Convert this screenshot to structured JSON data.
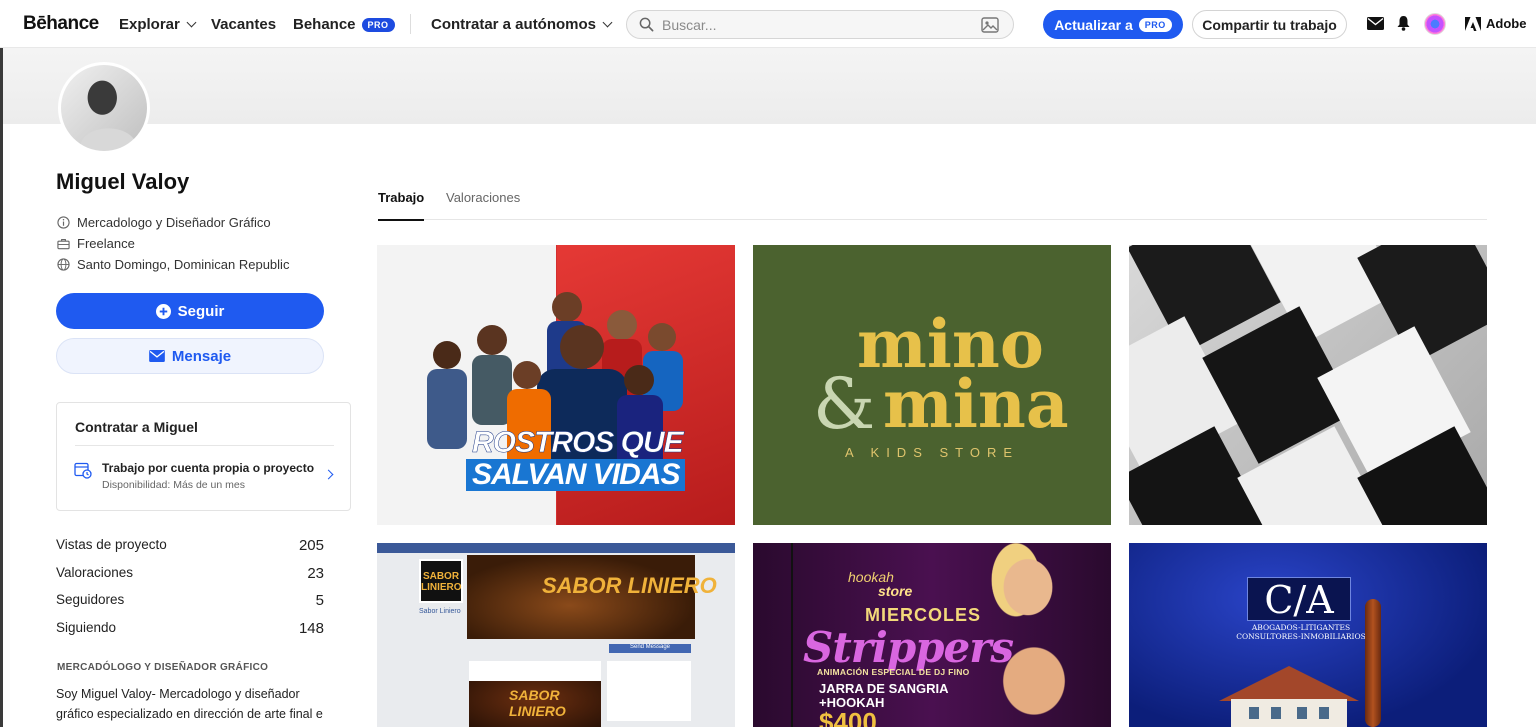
{
  "nav": {
    "logo": "Bēhance",
    "explore": "Explorar",
    "jobs": "Vacantes",
    "behance": "Behance",
    "pro_badge": "PRO",
    "hire": "Contratar a autónomos",
    "search_placeholder": "Buscar...",
    "upgrade": "Actualizar a",
    "share": "Compartir tu trabajo",
    "adobe": "Adobe"
  },
  "profile": {
    "name": "Miguel Valoy",
    "occupation": "Mercadologo y Diseñador Gráfico",
    "availability": "Freelance",
    "location": "Santo Domingo, Dominican Republic",
    "follow": "Seguir",
    "message": "Mensaje"
  },
  "hire_card": {
    "title": "Contratar a Miguel",
    "option_title": "Trabajo por cuenta propia o proyecto",
    "option_sub": "Disponibilidad: Más de un mes"
  },
  "stats": [
    {
      "label": "Vistas de proyecto",
      "value": "205"
    },
    {
      "label": "Valoraciones",
      "value": "23"
    },
    {
      "label": "Seguidores",
      "value": "5"
    },
    {
      "label": "Siguiendo",
      "value": "148"
    }
  ],
  "about": {
    "heading": "MERCADÓLOGO Y DISEÑADOR GRÁFICO",
    "text": "Soy Miguel Valoy- Mercadologo y diseñador gráfico especializado en dirección de arte final e"
  },
  "tabs": [
    {
      "label": "Trabajo",
      "active": true
    },
    {
      "label": "Valoraciones",
      "active": false
    }
  ],
  "projects": {
    "p1": {
      "line1": "ROSTROS QUE",
      "line2": "SALVAN VIDAS"
    },
    "p2": {
      "line1": "mino",
      "amp": "&",
      "line2": "mina",
      "tag": "A KIDS STORE"
    },
    "p4": {
      "brand": "SABOR LINIERO",
      "page_name": "Sabor Liniero",
      "button": "Send Message"
    },
    "p5": {
      "hookah": "hookah",
      "store": "store",
      "day": "MIERCOLES",
      "title": "Strippers",
      "subtitle": "ANIMACIÓN ESPECIAL DE DJ FINO",
      "offer": "JARRA DE SANGRIA",
      "offer2": "+HOOKAH",
      "price": "$400"
    },
    "p6": {
      "logo": "C/A",
      "sub1": "ABOGADOS-LITIGANTES",
      "sub2": "CONSULTORES-INMOBILIARIOS"
    }
  },
  "colors": {
    "accent": "#1f5af0",
    "card2_bg": "#4b622f",
    "card2_text": "#e7c14a"
  }
}
